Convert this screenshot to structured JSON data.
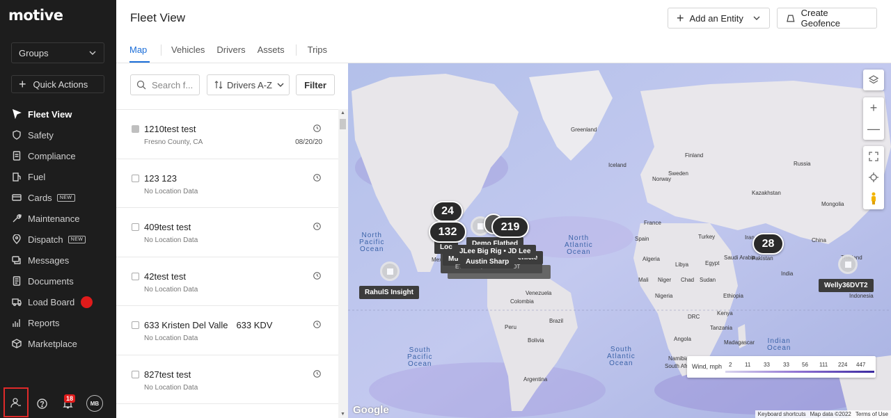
{
  "app": {
    "logo": "motive",
    "page_title": "Fleet View"
  },
  "sidebar": {
    "groups_label": "Groups",
    "quick_actions_label": "Quick Actions",
    "items": [
      {
        "label": "Fleet View",
        "icon": "map-pin-icon",
        "active": true
      },
      {
        "label": "Safety",
        "icon": "shield-icon"
      },
      {
        "label": "Compliance",
        "icon": "document-icon"
      },
      {
        "label": "Fuel",
        "icon": "fuel-pump-icon"
      },
      {
        "label": "Cards",
        "icon": "card-icon",
        "badge": "NEW"
      },
      {
        "label": "Maintenance",
        "icon": "wrench-icon"
      },
      {
        "label": "Dispatch",
        "icon": "location-icon",
        "badge": "NEW"
      },
      {
        "label": "Messages",
        "icon": "chat-icon"
      },
      {
        "label": "Documents",
        "icon": "file-icon"
      },
      {
        "label": "Load Board",
        "icon": "truck-icon",
        "dot": true
      },
      {
        "label": "Reports",
        "icon": "chart-icon"
      },
      {
        "label": "Marketplace",
        "icon": "cube-icon"
      }
    ],
    "notification_count": "18",
    "avatar_initials": "MB"
  },
  "header": {
    "add_entity_label": "Add an Entity",
    "create_geofence_label": "Create Geofence",
    "tabs": [
      "Map",
      "Vehicles",
      "Drivers",
      "Assets",
      "Trips"
    ],
    "active_tab": "Map"
  },
  "list_panel": {
    "search_placeholder": "Search f...",
    "sort_label": "Drivers A-Z",
    "filter_label": "Filter",
    "rows": [
      {
        "title": "1210test test",
        "plate": "",
        "sub": "Fresno County, CA",
        "date": "08/20/20"
      },
      {
        "title": "123 123",
        "plate": "",
        "sub": "No Location Data",
        "date": ""
      },
      {
        "title": "409test test",
        "plate": "",
        "sub": "No Location Data",
        "date": ""
      },
      {
        "title": "42test test",
        "plate": "",
        "sub": "No Location Data",
        "date": ""
      },
      {
        "title": "633 Kristen Del Valle",
        "plate": "633 KDV",
        "sub": "No Location Data",
        "date": ""
      },
      {
        "title": "827test test",
        "plate": "",
        "sub": "No Location Data",
        "date": ""
      }
    ]
  },
  "map": {
    "clusters": [
      "24",
      "132",
      "219",
      "28"
    ],
    "pin_labels": {
      "rahul": "RahulS Insight",
      "welly": "Welly36DVT2",
      "demo": "Demo Flatbed",
      "jlee": "JLee Big Rig • JD Lee",
      "austin": "Austin Sharp",
      "loc": "Loc",
      "mu": "Mu",
      "ehicle": "ehicle",
      "edt": "ETA 07/01, 03:29 AM EDT"
    },
    "oceans": {
      "north_pacific": "North\nPacific\nOcean",
      "north_atlantic": "North\nAtlantic\nOcean",
      "south_pacific": "South\nPacific\nOcean",
      "south_atlantic": "South\nAtlantic\nOcean",
      "indian": "Indian\nOcean"
    },
    "places": [
      "Greenland",
      "Iceland",
      "Finland",
      "Norway",
      "Sweden",
      "Russia",
      "France",
      "Spain",
      "Turkey",
      "China",
      "Algeria",
      "Libya",
      "Egypt",
      "Mali",
      "Niger",
      "Chad",
      "Sudan",
      "Nigeria",
      "Ethiopia",
      "Kenya",
      "DRC",
      "Tanzania",
      "Angola",
      "Namibia",
      "Madagascar",
      "Mexico",
      "Venezuela",
      "Colombia",
      "Peru",
      "Brazil",
      "Bolivia",
      "Argentina",
      "South Africa",
      "Pakistan",
      "Thailand",
      "Mongolia",
      "Kazakhstan",
      "Iran",
      "Saudi Arabia",
      "India",
      "Indonesia"
    ],
    "legend": {
      "title": "Wind, mph",
      "values": [
        "2",
        "11",
        "33",
        "33",
        "56",
        "111",
        "224",
        "447"
      ]
    },
    "google": "Google",
    "attribution": [
      "Keyboard shortcuts",
      "Map data ©2022",
      "Terms of Use"
    ]
  }
}
